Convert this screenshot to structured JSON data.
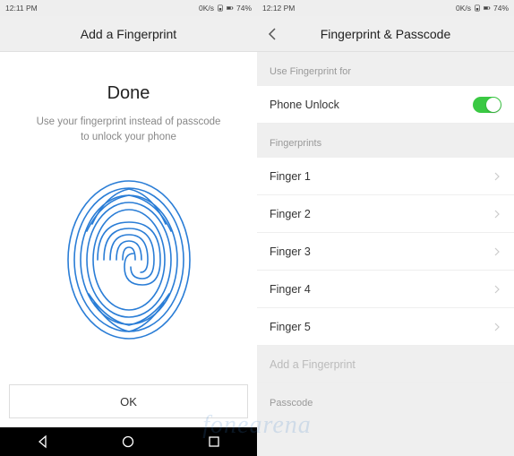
{
  "left": {
    "statusbar": {
      "time": "12:11 PM",
      "speed": "0K/s",
      "battery": "74%"
    },
    "header": {
      "title": "Add a Fingerprint"
    },
    "done": {
      "title": "Done",
      "subtitle": "Use your fingerprint instead of passcode to unlock your phone"
    },
    "ok_label": "OK"
  },
  "right": {
    "statusbar": {
      "time": "12:12 PM",
      "speed": "0K/s",
      "battery": "74%"
    },
    "header": {
      "title": "Fingerprint & Passcode"
    },
    "section1_label": "Use Fingerprint for",
    "phone_unlock_label": "Phone Unlock",
    "section2_label": "Fingerprints",
    "fingers": [
      {
        "label": "Finger 1"
      },
      {
        "label": "Finger 2"
      },
      {
        "label": "Finger 3"
      },
      {
        "label": "Finger 4"
      },
      {
        "label": "Finger 5"
      }
    ],
    "add_label": "Add a Fingerprint",
    "passcode_label": "Passcode"
  },
  "watermark": "fonearena"
}
